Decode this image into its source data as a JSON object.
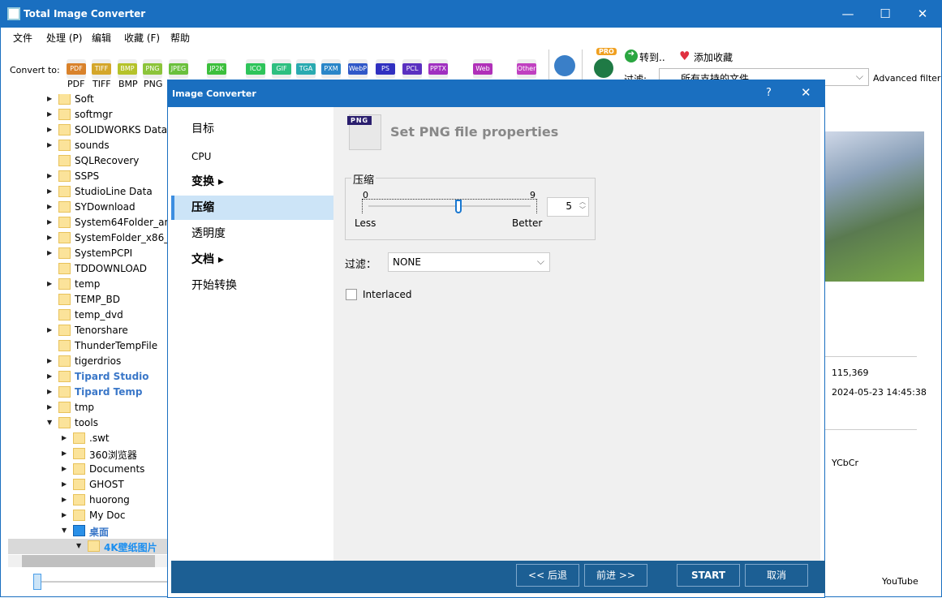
{
  "app": {
    "title": "Total Image Converter"
  },
  "menu": [
    "文件",
    "处理 (P)",
    "编辑",
    "收藏 (F)",
    "帮助"
  ],
  "toolbar": {
    "convert_to": "Convert to:",
    "formats": [
      {
        "n": "PDF",
        "c": "#d9822b",
        "l": "PDF"
      },
      {
        "n": "TIFF",
        "c": "#d4a62a",
        "l": "TIFF"
      },
      {
        "n": "BMP",
        "c": "#b5c22a",
        "l": "BMP"
      },
      {
        "n": "PNG",
        "c": "#8cc43a",
        "l": "PNG"
      },
      {
        "n": "JPEG",
        "c": "#6ac03c",
        "l": ""
      },
      {
        "n": "JP2K",
        "c": "#3cbf3c",
        "l": ""
      },
      {
        "n": "ICO",
        "c": "#2ec45a",
        "l": ""
      },
      {
        "n": "GIF",
        "c": "#2ebf80",
        "l": ""
      },
      {
        "n": "TGA",
        "c": "#2aaab0",
        "l": ""
      },
      {
        "n": "PXM",
        "c": "#2a86c8",
        "l": ""
      },
      {
        "n": "WebP",
        "c": "#3058c8",
        "l": ""
      },
      {
        "n": "PS",
        "c": "#3030c0",
        "l": ""
      },
      {
        "n": "PCL",
        "c": "#5a30c0",
        "l": ""
      },
      {
        "n": "PPTX",
        "c": "#a030c0",
        "l": ""
      },
      {
        "n": "Web",
        "c": "#b030b8",
        "l": ""
      },
      {
        "n": "Other",
        "c": "#c040c0",
        "l": "其他"
      }
    ],
    "goto": "转到..",
    "favorite": "添加收藏",
    "filter_label": "过滤:",
    "filter_value": "所有支持的文件",
    "advanced_filter": "Advanced filter",
    "pro": "PRO"
  },
  "tree": [
    {
      "t": "Soft",
      "l": 1,
      "e": 1
    },
    {
      "t": "softmgr",
      "l": 1,
      "e": 1
    },
    {
      "t": "SOLIDWORKS Data",
      "l": 1,
      "e": 1
    },
    {
      "t": "sounds",
      "l": 1,
      "e": 1
    },
    {
      "t": "SQLRecovery",
      "l": 1,
      "e": 0
    },
    {
      "t": "SSPS",
      "l": 1,
      "e": 1
    },
    {
      "t": "StudioLine Data",
      "l": 1,
      "e": 1
    },
    {
      "t": "SYDownload",
      "l": 1,
      "e": 1
    },
    {
      "t": "System64Folder_am",
      "l": 1,
      "e": 1
    },
    {
      "t": "SystemFolder_x86_",
      "l": 1,
      "e": 1
    },
    {
      "t": "SystemPCPI",
      "l": 1,
      "e": 1
    },
    {
      "t": "TDDOWNLOAD",
      "l": 1,
      "e": 0
    },
    {
      "t": "temp",
      "l": 1,
      "e": 1
    },
    {
      "t": "TEMP_BD",
      "l": 1,
      "e": 0
    },
    {
      "t": "temp_dvd",
      "l": 1,
      "e": 0
    },
    {
      "t": "Tenorshare",
      "l": 1,
      "e": 1
    },
    {
      "t": "ThunderTempFile",
      "l": 1,
      "e": 0
    },
    {
      "t": "tigerdrios",
      "l": 1,
      "e": 1
    },
    {
      "t": "Tipard Studio",
      "l": 1,
      "e": 1,
      "b": 1
    },
    {
      "t": "Tipard Temp",
      "l": 1,
      "e": 1,
      "b": 1
    },
    {
      "t": "tmp",
      "l": 1,
      "e": 1
    },
    {
      "t": "tools",
      "l": 1,
      "e": 2
    },
    {
      "t": ".swt",
      "l": 2,
      "e": 1
    },
    {
      "t": "360浏览器",
      "l": 2,
      "e": 1
    },
    {
      "t": "Documents",
      "l": 2,
      "e": 1
    },
    {
      "t": "GHOST",
      "l": 2,
      "e": 1
    },
    {
      "t": "huorong",
      "l": 2,
      "e": 1
    },
    {
      "t": "My Doc",
      "l": 2,
      "e": 1
    },
    {
      "t": "桌面",
      "l": 2,
      "e": 2,
      "b": 1,
      "d": 1
    },
    {
      "t": "4K壁纸图片",
      "l": 3,
      "e": 2,
      "b": 1,
      "s": 1
    }
  ],
  "dialog": {
    "title": "Image Converter",
    "help": "?",
    "nav": [
      {
        "t": "目标"
      },
      {
        "t": "CPU"
      },
      {
        "t": "变换 ▸",
        "b": 1
      },
      {
        "t": "压缩",
        "s": 1,
        "b": 1
      },
      {
        "t": "透明度"
      },
      {
        "t": "文档 ▸",
        "b": 1
      },
      {
        "t": "开始转换"
      }
    ],
    "heading": "Set PNG file properties",
    "icon_label": "PNG",
    "compression": {
      "legend": "压缩",
      "min": "0",
      "max": "9",
      "less": "Less",
      "better": "Better",
      "value": 5,
      "value_text": "5"
    },
    "filter_label": "过滤：",
    "filter_value": "NONE",
    "interlaced": "Interlaced",
    "interlaced_checked": false,
    "back": "<< 后退",
    "next": "前进 >>",
    "start": "START",
    "cancel": "取消"
  },
  "info": {
    "size": "115,369",
    "date": "2024-05-23 14:45:38",
    "color": "YCbCr",
    "footer": "YouTube"
  }
}
